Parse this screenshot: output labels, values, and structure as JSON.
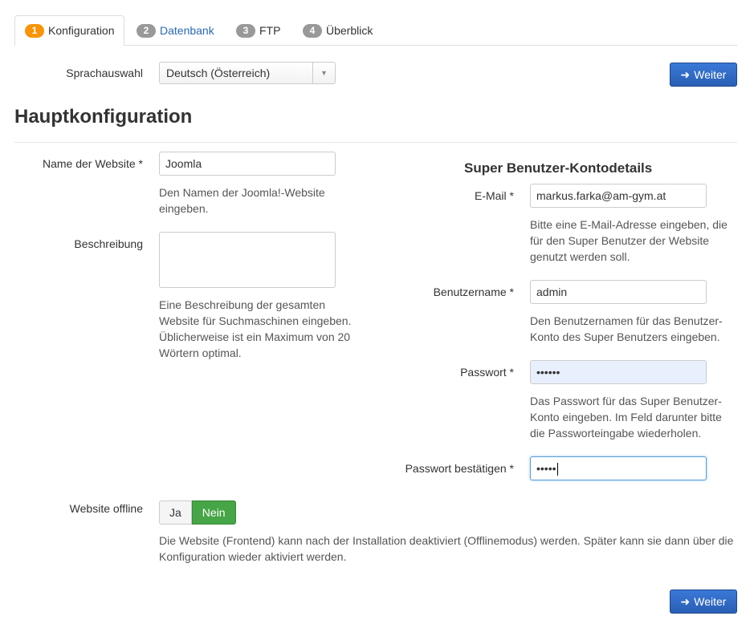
{
  "tabs": [
    {
      "num": "1",
      "label": "Konfiguration"
    },
    {
      "num": "2",
      "label": "Datenbank"
    },
    {
      "num": "3",
      "label": "FTP"
    },
    {
      "num": "4",
      "label": "Überblick"
    }
  ],
  "language": {
    "label": "Sprachauswahl",
    "selected": "Deutsch (Österreich)"
  },
  "next_button": "Weiter",
  "main_heading": "Hauptkonfiguration",
  "site_name": {
    "label": "Name der Website *",
    "value": "Joomla",
    "help": "Den Namen der Joomla!-Website eingeben."
  },
  "description": {
    "label": "Beschreibung",
    "value": "",
    "help": "Eine Beschreibung der gesamten Website für Suchmaschinen eingeben. Üblicherweise ist ein Maximum von 20 Wörtern optimal."
  },
  "super_user": {
    "heading": "Super Benutzer-Kontodetails",
    "email": {
      "label": "E-Mail *",
      "value": "markus.farka@am-gym.at",
      "help": "Bitte eine E-Mail-Adresse eingeben, die für den Super Benutzer der Website genutzt werden soll."
    },
    "username": {
      "label": "Benutzername *",
      "value": "admin",
      "help": "Den Benutzernamen für das Benutzer-Konto des Super Benutzers eingeben."
    },
    "password": {
      "label": "Passwort *",
      "value": "••••••",
      "help": "Das Passwort für das Super Benutzer-Konto eingeben. Im Feld darunter bitte die Passworteingabe wiederholen."
    },
    "password_confirm": {
      "label": "Passwort bestätigen *",
      "value": "•••••"
    }
  },
  "offline": {
    "label": "Website offline",
    "option_yes": "Ja",
    "option_no": "Nein",
    "selected": "Nein",
    "help": "Die Website (Frontend) kann nach der Installation deaktiviert (Offlinemodus) werden. Später kann sie dann über die Konfiguration wieder aktiviert werden."
  },
  "icons": {
    "next": "arrow-right-icon",
    "dropdown": "chevron-down-icon"
  },
  "colors": {
    "primary": "#2a5fb5",
    "active_step": "#f89406",
    "toggle_on": "#46a546"
  }
}
